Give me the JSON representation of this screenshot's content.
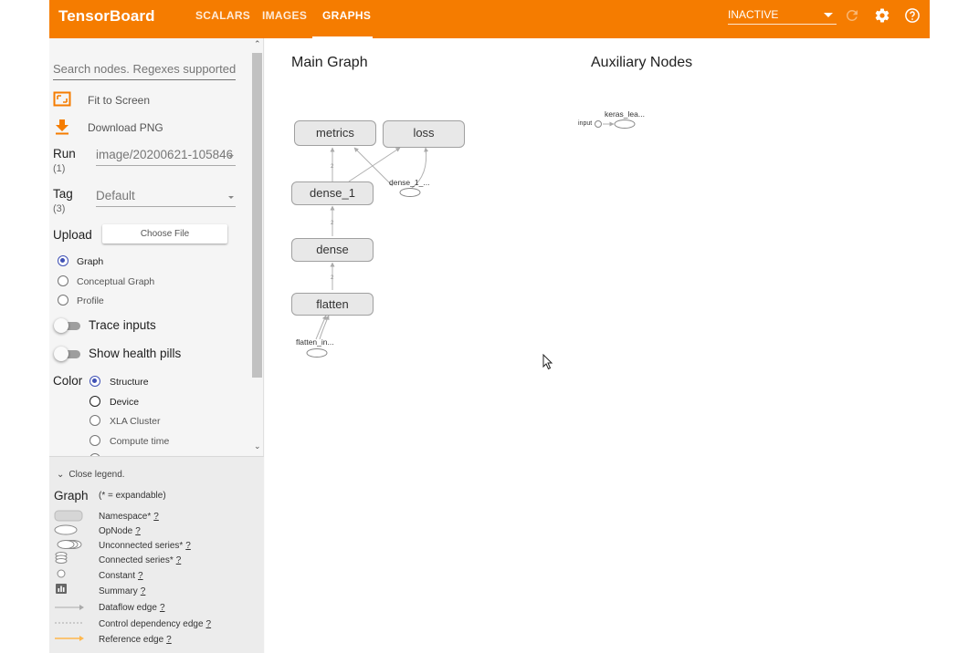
{
  "header": {
    "brand": "TensorBoard",
    "tabs": [
      {
        "label": "SCALARS"
      },
      {
        "label": "IMAGES"
      },
      {
        "label": "GRAPHS",
        "active": true
      }
    ],
    "run_selector": "INACTIVE",
    "icons": [
      "refresh-icon",
      "settings-gear-icon",
      "help-icon"
    ],
    "accent_color": "#f57c00"
  },
  "sidebar": {
    "search_placeholder": "Search nodes. Regexes supported.",
    "fit_to_screen": "Fit to Screen",
    "download_png": "Download PNG",
    "run": {
      "label": "Run",
      "count": "(1)",
      "value": "image/20200621-105846"
    },
    "tag": {
      "label": "Tag",
      "count": "(3)",
      "value": "Default"
    },
    "upload": {
      "label": "Upload",
      "button": "Choose File"
    },
    "graph_modes": [
      {
        "label": "Graph",
        "selected": true
      },
      {
        "label": "Conceptual Graph",
        "selected": false
      },
      {
        "label": "Profile",
        "selected": false
      }
    ],
    "trace_inputs": "Trace inputs",
    "show_health_pills": "Show health pills",
    "color": {
      "label": "Color",
      "options": [
        {
          "label": "Structure",
          "selected": true
        },
        {
          "label": "Device",
          "selected": false
        },
        {
          "label": "XLA Cluster",
          "selected": false
        },
        {
          "label": "Compute time",
          "selected": false
        }
      ]
    }
  },
  "legend": {
    "close": "Close legend.",
    "title": "Graph",
    "expandable_note": "(* = expandable)",
    "help_mark": "?",
    "items": [
      {
        "label": "Namespace*"
      },
      {
        "label": "OpNode"
      },
      {
        "label": "Unconnected series*"
      },
      {
        "label": "Connected series*"
      },
      {
        "label": "Constant"
      },
      {
        "label": "Summary"
      },
      {
        "label": "Dataflow edge"
      },
      {
        "label": "Control dependency edge"
      },
      {
        "label": "Reference edge"
      }
    ]
  },
  "graph": {
    "main_title": "Main Graph",
    "aux_title": "Auxiliary Nodes",
    "nodes": {
      "metrics": "metrics",
      "loss": "loss",
      "dense_1": "dense_1",
      "dense": "dense",
      "flatten": "flatten",
      "flatten_input": "flatten_in...",
      "dense_1_target": "dense_1_...",
      "keras_learning_phase": "keras_lea...",
      "aux_input": "input"
    }
  }
}
